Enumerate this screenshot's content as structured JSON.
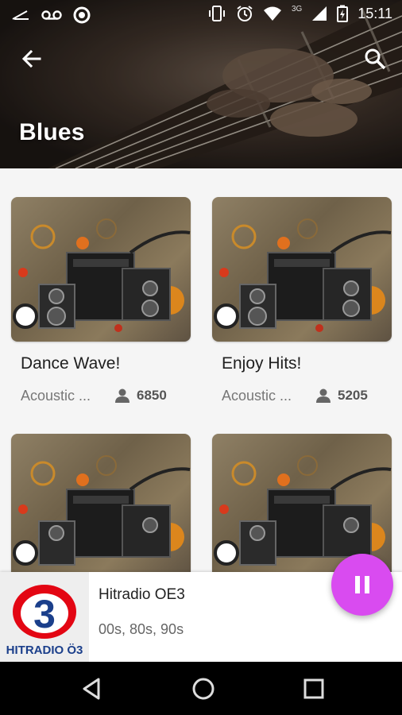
{
  "status_bar": {
    "time": "15:11",
    "network": "3G",
    "icons": [
      "missed-call-icon",
      "voicemail-icon",
      "circle-notification-icon",
      "vibrate-icon",
      "alarm-icon",
      "wifi-icon",
      "signal-icon",
      "battery-icon"
    ]
  },
  "header": {
    "title": "Blues",
    "back_icon": "arrow-left-icon",
    "search_icon": "search-icon"
  },
  "stations": [
    {
      "title": "Dance Wave!",
      "genre": "Acoustic ...",
      "listeners": "6850"
    },
    {
      "title": "Enjoy Hits!",
      "genre": "Acoustic ...",
      "listeners": "5205"
    },
    {
      "title": "",
      "genre": "",
      "listeners": ""
    },
    {
      "title": "",
      "genre": "",
      "listeners": ""
    }
  ],
  "now_playing": {
    "station": "Hitradio OE3",
    "genres": "00s, 80s, 90s",
    "logo_text": "HITRADIO Ö3",
    "logo_numeral": "3",
    "pause_icon": "pause-icon"
  },
  "colors": {
    "accent": "#d94bf0",
    "logo_red": "#e30613",
    "logo_blue": "#1b3f8b"
  },
  "nav": {
    "back": "nav-back-icon",
    "home": "nav-home-icon",
    "recents": "nav-recents-icon"
  }
}
